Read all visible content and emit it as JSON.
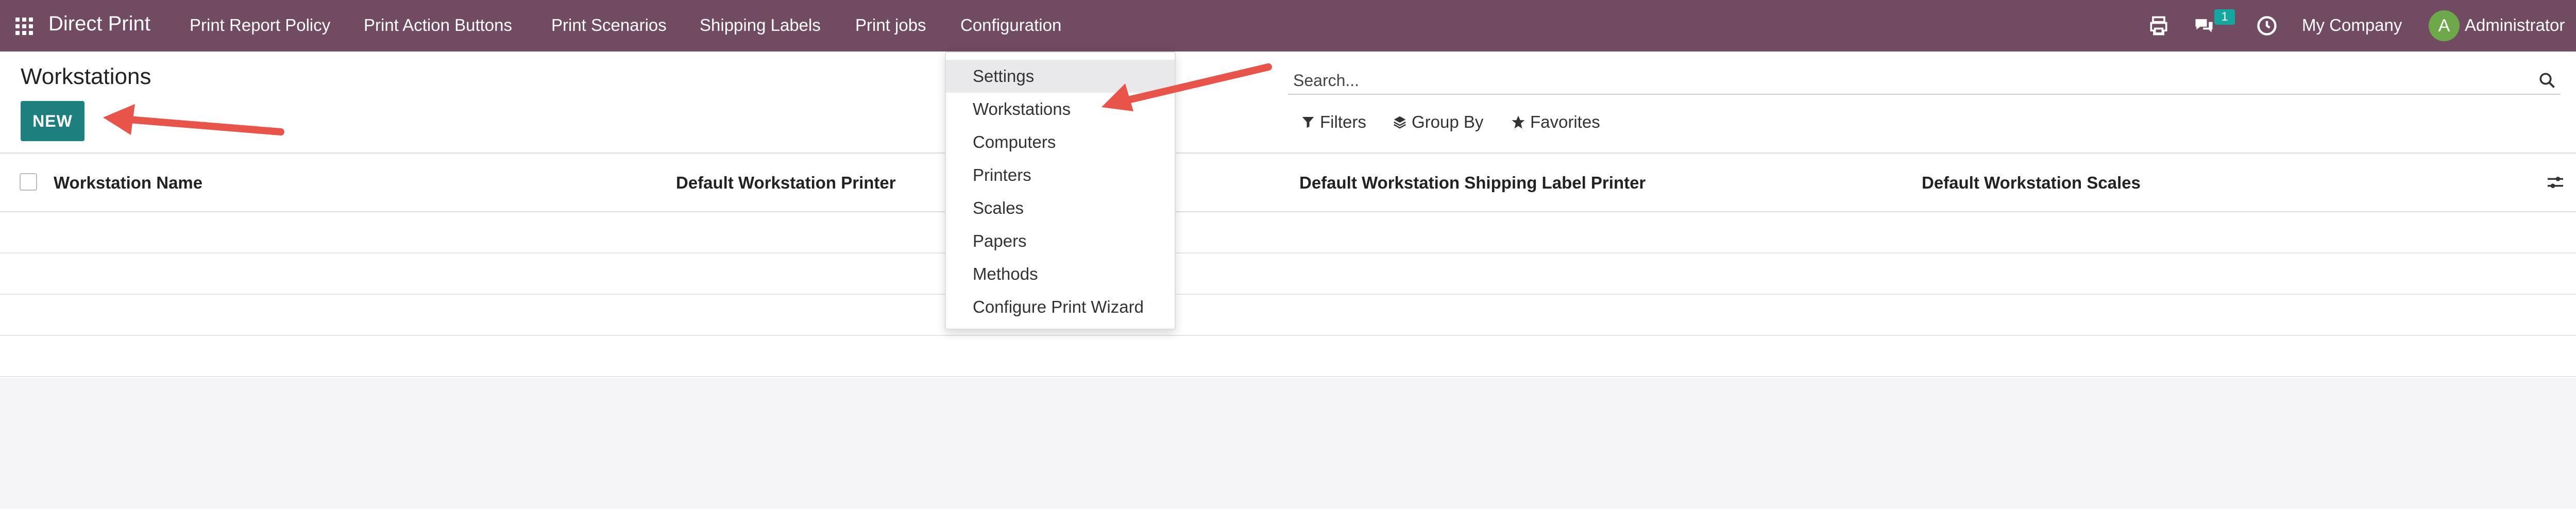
{
  "topbar": {
    "brand": "Direct Print",
    "menu": [
      "Print Report Policy",
      "Print Action Buttons",
      "Print Scenarios",
      "Shipping Labels",
      "Print jobs",
      "Configuration"
    ],
    "message_count": "1",
    "company": "My Company",
    "avatar_letter": "A",
    "user": "Administrator"
  },
  "control_panel": {
    "title": "Workstations",
    "new_label": "NEW",
    "search_placeholder": "Search...",
    "filters_label": "Filters",
    "group_by_label": "Group By",
    "favorites_label": "Favorites"
  },
  "list": {
    "columns": [
      "Workstation Name",
      "Default Workstation Printer",
      "Default Workstation Shipping Label Printer",
      "Default Workstation Scales"
    ]
  },
  "configuration_menu": {
    "items": [
      "Settings",
      "Workstations",
      "Computers",
      "Printers",
      "Scales",
      "Papers",
      "Methods",
      "Configure Print Wizard"
    ]
  },
  "colors": {
    "topbar": "#704b62",
    "primary_button": "#1d7f7e",
    "badge": "#16a6a0",
    "avatar": "#6da84a",
    "annotation_arrow": "#e8534a"
  }
}
